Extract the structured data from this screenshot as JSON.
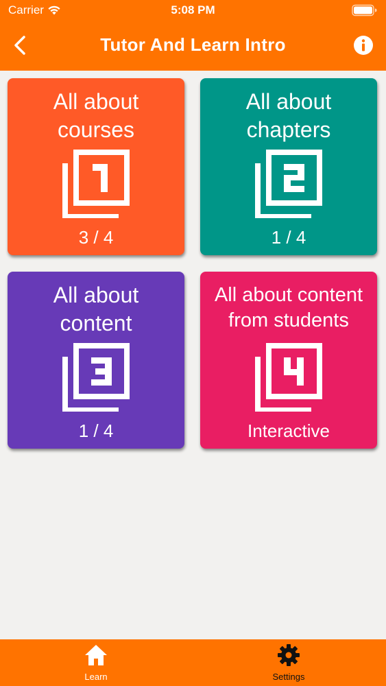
{
  "status_bar": {
    "carrier": "Carrier",
    "time": "5:08 PM"
  },
  "nav": {
    "title": "Tutor And Learn Intro",
    "back_icon": "chevron-left-icon",
    "info_icon": "info-icon"
  },
  "colors": {
    "header": "#ff7300",
    "background": "#f2f1ef",
    "card_courses": "#ff5a27",
    "card_chapters": "#009688",
    "card_content": "#673ab7",
    "card_students": "#e91e63"
  },
  "cards": [
    {
      "title": "All about courses",
      "title_line1": "All about",
      "title_line2": "courses",
      "number": "1",
      "icon": "filter-1-icon",
      "progress": "3 / 4"
    },
    {
      "title": "All about chapters",
      "title_line1": "All about",
      "title_line2": "chapters",
      "number": "2",
      "icon": "filter-2-icon",
      "progress": "1 / 4"
    },
    {
      "title": "All about content",
      "title_line1": "All about",
      "title_line2": "content",
      "number": "3",
      "icon": "filter-3-icon",
      "progress": "1 / 4"
    },
    {
      "title": "All about content from students",
      "title_line1": "All about content",
      "title_line2": "from students",
      "number": "4",
      "icon": "filter-4-icon",
      "progress": "Interactive"
    }
  ],
  "tabbar": {
    "items": [
      {
        "label": "Learn",
        "icon": "home-icon",
        "active": true
      },
      {
        "label": "Settings",
        "icon": "gear-icon",
        "active": false
      }
    ]
  }
}
